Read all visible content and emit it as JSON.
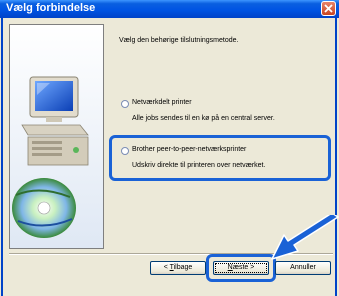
{
  "window": {
    "title": "Vælg forbindelse"
  },
  "instruction": "Vælg den behørige tilslutningsmetode.",
  "options": [
    {
      "label": "Netværkdelt printer",
      "description": "Alle jobs sendes til en kø på en central server.",
      "selected": false
    },
    {
      "label": "Brother peer-to-peer-netværksprinter",
      "description": "Udskriv direkte til printeren over netværket.",
      "selected": false
    }
  ],
  "buttons": {
    "back": {
      "prefix": "< ",
      "mnemonic": "T",
      "rest": "ilbage"
    },
    "next": {
      "mnemonic": "N",
      "rest": "æste >"
    },
    "cancel": "Annuller"
  },
  "colors": {
    "titlebar": "#0054e3",
    "highlight": "#1a62d6",
    "dialog_bg": "#ece9d8",
    "close_button": "#c94522"
  }
}
